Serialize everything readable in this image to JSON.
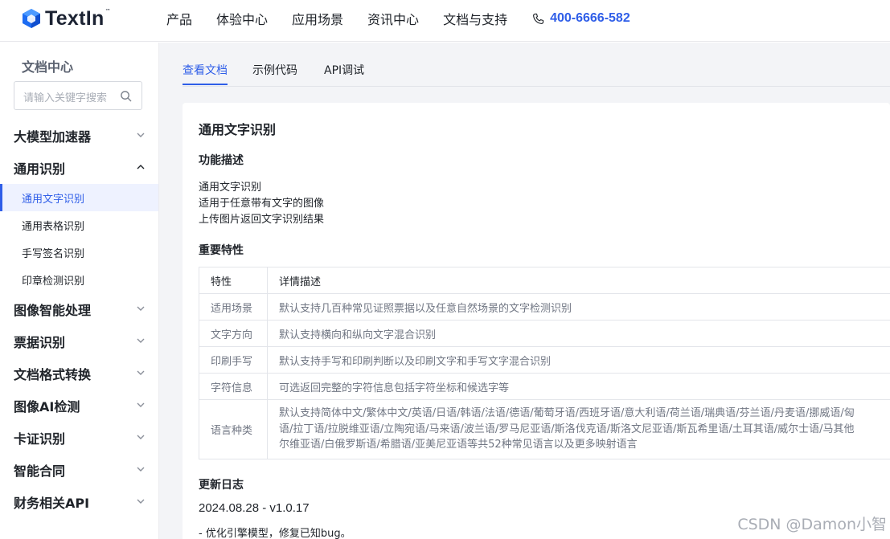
{
  "header": {
    "logo_text": "TextIn",
    "logo_tm": "™",
    "nav": [
      "产品",
      "体验中心",
      "应用场景",
      "资讯中心",
      "文档与支持"
    ],
    "phone": "400-6666-582"
  },
  "sidebar": {
    "title": "文档中心",
    "search_placeholder": "请输入关键字搜索",
    "groups": [
      {
        "label": "大模型加速器",
        "expanded": false
      },
      {
        "label": "通用识别",
        "expanded": true,
        "items": [
          "通用文字识别",
          "通用表格识别",
          "手写签名识别",
          "印章检测识别"
        ],
        "active_item": "通用文字识别"
      },
      {
        "label": "图像智能处理",
        "expanded": false
      },
      {
        "label": "票据识别",
        "expanded": false
      },
      {
        "label": "文档格式转换",
        "expanded": false
      },
      {
        "label": "图像AI检测",
        "expanded": false
      },
      {
        "label": "卡证识别",
        "expanded": false
      },
      {
        "label": "智能合同",
        "expanded": false
      },
      {
        "label": "财务相关API",
        "expanded": false
      }
    ]
  },
  "tabs": [
    {
      "label": "查看文档",
      "active": true
    },
    {
      "label": "示例代码",
      "active": false
    },
    {
      "label": "API调试",
      "active": false
    }
  ],
  "doc": {
    "title": "通用文字识别",
    "func_heading": "功能描述",
    "func_lines": [
      "通用文字识别",
      "适用于任意带有文字的图像",
      "上传图片返回文字识别结果"
    ],
    "features_heading": "重要特性",
    "table": {
      "headers": [
        "特性",
        "详情描述"
      ],
      "rows": [
        [
          "适用场景",
          "默认支持几百种常见证照票据以及任意自然场景的文字检测识别"
        ],
        [
          "文字方向",
          "默认支持横向和纵向文字混合识别"
        ],
        [
          "印刷手写",
          "默认支持手写和印刷判断以及印刷文字和手写文字混合识别"
        ],
        [
          "字符信息",
          "可选返回完整的字符信息包括字符坐标和候选字等"
        ]
      ],
      "lang_row": {
        "label": "语言种类",
        "lines": [
          "默认支持简体中文/繁体中文/英语/日语/韩语/法语/德语/葡萄牙语/西班牙语/意大利语/荷兰语/瑞典语/芬兰语/丹麦语/挪威语/匈",
          "语/拉丁语/拉脱维亚语/立陶宛语/马来语/波兰语/罗马尼亚语/斯洛伐克语/斯洛文尼亚语/斯瓦希里语/土耳其语/威尔士语/马其他",
          "尔维亚语/白俄罗斯语/希腊语/亚美尼亚语等共52种常见语言以及更多映射语言"
        ]
      }
    },
    "changelog_heading": "更新日志",
    "version": "2024.08.28 - v1.0.17",
    "change": "- 优化引擎模型，修复已知bug。"
  },
  "watermark": "CSDN @Damon小智",
  "colors": {
    "accent": "#2f5ee8",
    "logo_blue": "#1d6cf2",
    "main_bg": "#f3f4f7"
  }
}
